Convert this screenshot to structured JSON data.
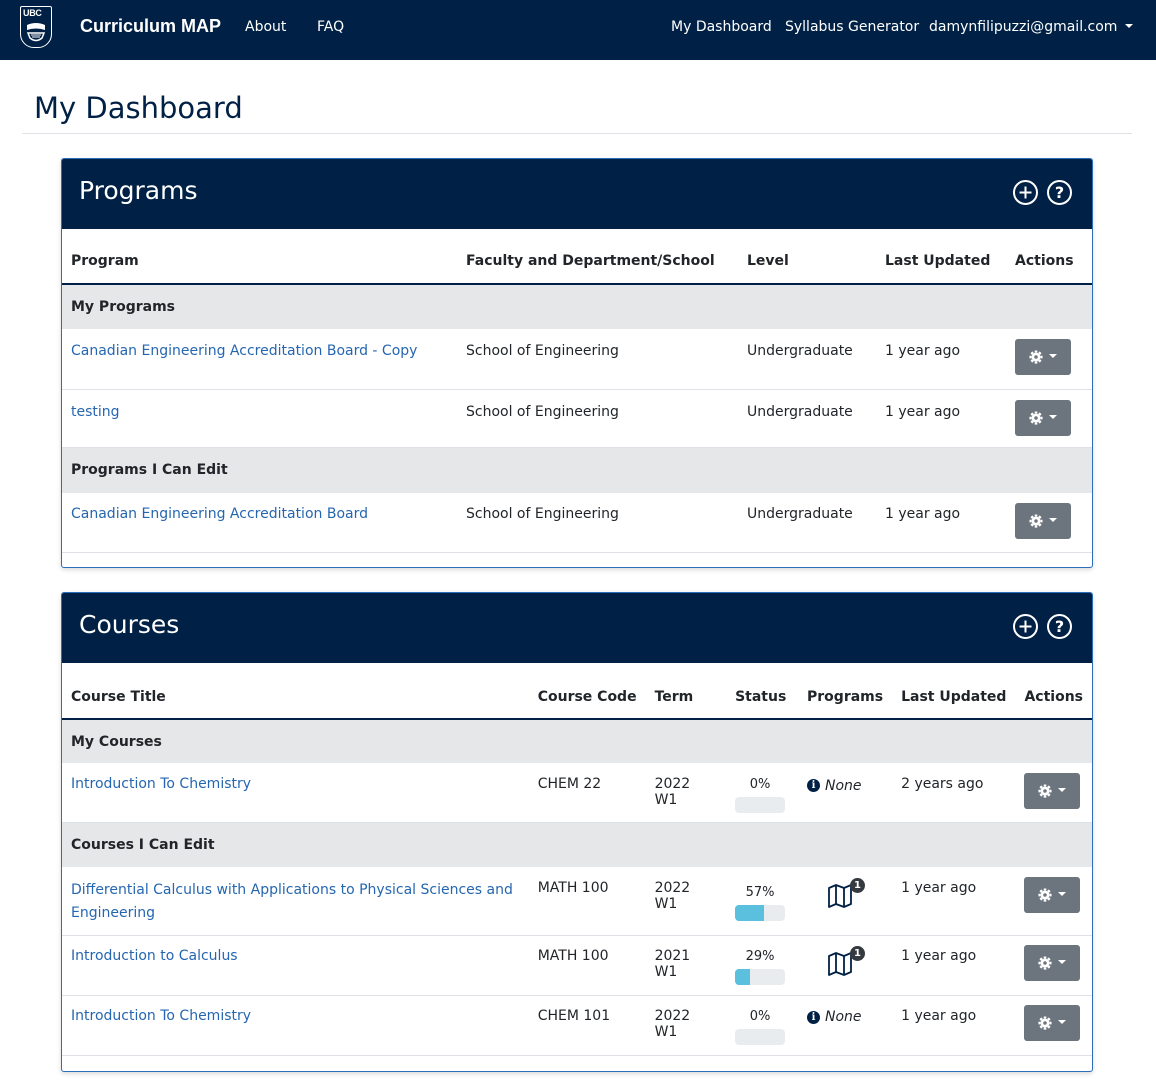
{
  "nav": {
    "logo_text": "UBC",
    "brand": "Curriculum MAP",
    "about": "About",
    "faq": "FAQ",
    "dashboard": "My Dashboard",
    "syllabus": "Syllabus Generator",
    "user": "damynfilipuzzi@gmail.com"
  },
  "page": {
    "title": "My Dashboard"
  },
  "programs": {
    "title": "Programs",
    "headers": {
      "program": "Program",
      "faculty": "Faculty and Department/School",
      "level": "Level",
      "updated": "Last Updated",
      "actions": "Actions"
    },
    "groups": [
      {
        "label": "My Programs",
        "rows": [
          {
            "name": "Canadian Engineering Accreditation Board - Copy",
            "faculty": "School of Engineering",
            "level": "Undergraduate",
            "updated": "1 year ago"
          },
          {
            "name": "testing",
            "faculty": "School of Engineering",
            "level": "Undergraduate",
            "updated": "1 year ago"
          }
        ]
      },
      {
        "label": "Programs I Can Edit",
        "rows": [
          {
            "name": "Canadian Engineering Accreditation Board",
            "faculty": "School of Engineering",
            "level": "Undergraduate",
            "updated": "1 year ago"
          }
        ]
      }
    ]
  },
  "courses": {
    "title": "Courses",
    "headers": {
      "title": "Course Title",
      "code": "Course Code",
      "term": "Term",
      "status": "Status",
      "programs": "Programs",
      "updated": "Last Updated",
      "actions": "Actions"
    },
    "groups": [
      {
        "label": "My Courses",
        "rows": [
          {
            "title": "Introduction To Chemistry",
            "code": "CHEM 22",
            "term": "2022 W1",
            "status": "0%",
            "progress": 0,
            "programs": "None",
            "updated": "2 years ago"
          }
        ]
      },
      {
        "label": "Courses I Can Edit",
        "rows": [
          {
            "title": "Differential Calculus with Applications to Physical Sciences and Engineering",
            "code": "MATH 100",
            "term": "2022 W1",
            "status": "57%",
            "progress": 57,
            "program_count": "1",
            "updated": "1 year ago"
          },
          {
            "title": "Introduction to Calculus",
            "code": "MATH 100",
            "term": "2021 W1",
            "status": "29%",
            "progress": 29,
            "program_count": "1",
            "updated": "1 year ago"
          },
          {
            "title": "Introduction To Chemistry",
            "code": "CHEM 101",
            "term": "2022 W1",
            "status": "0%",
            "progress": 0,
            "programs": "None",
            "updated": "1 year ago"
          }
        ]
      }
    ]
  },
  "icons": {
    "add": "plus-circle-icon",
    "help": "question-circle-icon",
    "gear": "gear-icon",
    "map": "map-icon",
    "info": "info-icon"
  },
  "colors": {
    "navy": "#002145",
    "link": "#2566b0",
    "progress": "#5bc0de",
    "button": "#6c757d",
    "group_bg": "#e6e7e9"
  }
}
